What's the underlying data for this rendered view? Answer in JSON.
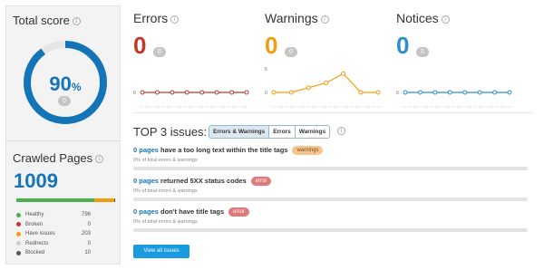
{
  "total_score": {
    "title": "Total score",
    "value": "90",
    "unit": "%",
    "delta": "0",
    "fraction": 0.9
  },
  "crawled": {
    "title": "Crawled Pages",
    "value": "1009",
    "legend": [
      {
        "label": "Healthy",
        "value": "796",
        "color": "#4caf50"
      },
      {
        "label": "Broken",
        "value": "0",
        "color": "#c0392b"
      },
      {
        "label": "Have issues",
        "value": "203",
        "color": "#f39c12"
      },
      {
        "label": "Redirects",
        "value": "0",
        "color": "#cccccc"
      },
      {
        "label": "Blocked",
        "value": "10",
        "color": "#555555"
      }
    ],
    "bar": [
      {
        "share": 0.789,
        "color": "#4caf50"
      },
      {
        "share": 0.201,
        "color": "#f39c12"
      },
      {
        "share": 0.01,
        "color": "#555555"
      }
    ]
  },
  "metrics": {
    "errors": {
      "title": "Errors",
      "value": "0",
      "delta": "0",
      "color": "#c0392b",
      "axis": [
        "0"
      ],
      "series": [
        0,
        0,
        0,
        0,
        0,
        0,
        0,
        0
      ]
    },
    "warnings": {
      "title": "Warnings",
      "value": "0",
      "delta": "0",
      "color": "#f39c12",
      "axis": [
        "5",
        "0"
      ],
      "series": [
        0,
        0,
        1,
        2,
        4,
        0,
        0
      ]
    },
    "notices": {
      "title": "Notices",
      "value": "0",
      "delta": "0",
      "color": "#2a8fd0",
      "axis": [
        "0"
      ],
      "series": [
        0,
        0,
        0,
        0,
        0,
        0,
        0,
        0
      ]
    }
  },
  "top_issues": {
    "title": "TOP 3 issues:",
    "tabs": [
      "Errors & Warnings",
      "Errors",
      "Warnings"
    ],
    "items": [
      {
        "count": "0 pages",
        "text": " have a too long text within the title tags",
        "tag": "warnings",
        "sub": "0% of total errors & warnings"
      },
      {
        "count": "0 pages",
        "text": " returned 5XX status codes",
        "tag": "error",
        "sub": "0% of total errors & warnings"
      },
      {
        "count": "0 pages",
        "text": " don't have title tags",
        "tag": "error",
        "sub": "0% of total errors & warnings"
      }
    ],
    "button": "View all issues"
  }
}
